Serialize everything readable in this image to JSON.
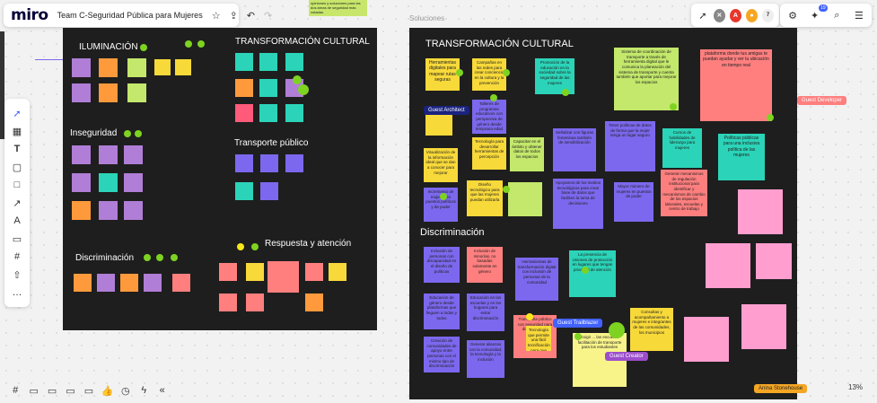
{
  "app": {
    "logo": "miro",
    "board_title": "Team C-Seguridad Pública para Mujeres",
    "frame_name": "Soluciones",
    "participant_count": "7",
    "notification_count": "19",
    "zoom": "13%",
    "top_note": "opiniones y soluciones para las dos áreas de seguridad más votadas."
  },
  "colors": {
    "accent": "#4262ff",
    "frame_bg": "#1e1e1e",
    "vote_dot": "#7ed321"
  },
  "left_frame": {
    "titles": {
      "iluminacion": "ILUMINACIÓN",
      "inseguridad": "Inseguridad",
      "discriminacion": "Discriminación",
      "cultural": "TRANSFORMACIÓN CULTURAL",
      "transporte": "Transporte público",
      "respuesta": "Respuesta y atención"
    }
  },
  "right_frame": {
    "titles": {
      "cultural": "TRANSFORMACIÓN CULTURAL",
      "discriminacion": "Discriminación"
    },
    "notes": [
      "Herramientas digitales para mapear rutas seguras",
      "Campañas en las redes para crear conciencia en la cultura y la prevención",
      "Promoción de la educación en la sociedad sobre la seguridad de las mujeres",
      "Sistema de coordinación de transporte a través de herramienta digital que le comunica la planeación del sistema de transporte y cuenta también que aportar para mejorar los espacios",
      "plataforma donde tus amigas te puedan ayudar y ver tu ubicación en tiempo real",
      "Talleres de programas educativos con perspectiva de género desde temprana edad",
      "Tecnología para desarrollar herramientas de percepción",
      "Capacitar en el ámbito y obtener datos de todos los espacios",
      "Señalizar con figuras femeninas también de sensibilización",
      "Tener políticas de datos de forma que la mujer tenga un lugar seguro",
      "Cursos de habilidades de liderazgo para mujeres",
      "Políticas públicas para una inclusiva política de las mujeres",
      "Visualización de la información ideal que se dan a conocer para mejorar",
      "Incremento de mujeres en puestos políticos y de poder",
      "Diseño tecnológico para que las mujeres puedan utilizarla",
      "Apoyamos de los medios tecnológicos para crear base de datos que faciliten la toma de decisiones",
      "Mayor número de mujeres en puestos de poder",
      "Generar mecanismos de regulación institucional para identificar y mecanismos de cambio de los espacios laborales, escuelas y centro de trabajo",
      "Inclusión de personas con discapacidad en el diseño de políticas",
      "Inclusión de minorías, no basadas solamente en género",
      "Herramientas de transformación digital con inclusión de personas de la comunidad",
      "La presencia de Uniones de protección en lugares que tengan prioridad de atención",
      "Educación de género desde plataformas que lleguen a todas y todos",
      "Educación en las escuelas y en los hogares para evitar discriminación",
      "Creación de comunidades de apoyo entre personas con el mismo tipo de discriminación",
      "Consultas y acompañamiento a mujeres e integrantes de las comunidades, los municipios",
      "Generar alianzas con la comunidad, la tecnología y la inclusión",
      "Tecnología que permite una fácil tecnificación para que estudiantes de escuelas tengan las mismas oportunidades",
      "Transporte público con seguridad para discriminación",
      "Exigir ... las escuelas facilitación de transporte para los estudiantes"
    ]
  },
  "cursors": {
    "architect": "Guest Architect",
    "developer": "Guest Developer",
    "trailblazer": "Guest Trailblazer",
    "creator": "Guest Creator",
    "stonehouse": "Anina Stonehouse"
  }
}
